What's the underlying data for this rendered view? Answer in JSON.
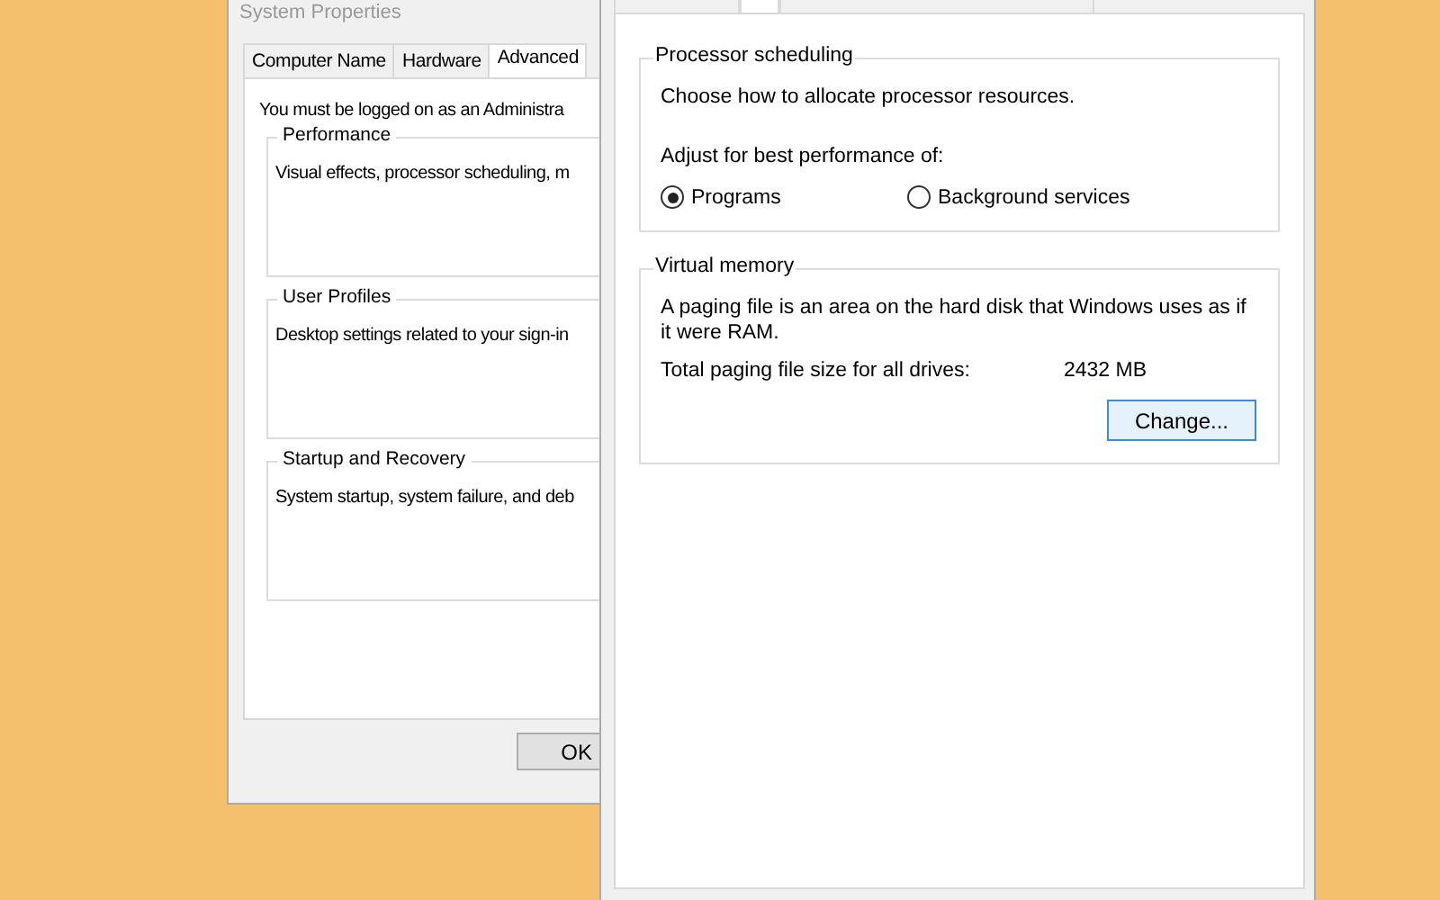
{
  "back_window": {
    "title": "System Properties",
    "tabs": [
      {
        "label": "Computer Name",
        "selected": false
      },
      {
        "label": "Hardware",
        "selected": false
      },
      {
        "label": "Advanced",
        "selected": true
      }
    ],
    "notice": "You must be logged on as an Administra",
    "groups": [
      {
        "title": "Performance",
        "text": "Visual effects, processor scheduling, m"
      },
      {
        "title": "User Profiles",
        "text": "Desktop settings related to your sign-in"
      },
      {
        "title": "Startup and Recovery",
        "text": "System startup, system failure, and deb"
      }
    ],
    "ok_button": "OK"
  },
  "front_window": {
    "tabs": [
      {
        "selected": false
      },
      {
        "selected": true
      },
      {
        "selected": false
      }
    ],
    "processor_scheduling": {
      "title": "Processor scheduling",
      "description": "Choose how to allocate processor resources.",
      "adjust_label": "Adjust for best performance of:",
      "options": [
        {
          "label": "Programs",
          "selected": true
        },
        {
          "label": "Background services",
          "selected": false
        }
      ]
    },
    "virtual_memory": {
      "title": "Virtual memory",
      "description": "A paging file is an area on the hard disk that Windows uses as if it were RAM.",
      "size_label": "Total paging file size for all drives:",
      "size_value": "2432 MB",
      "change_button": "Change..."
    }
  }
}
